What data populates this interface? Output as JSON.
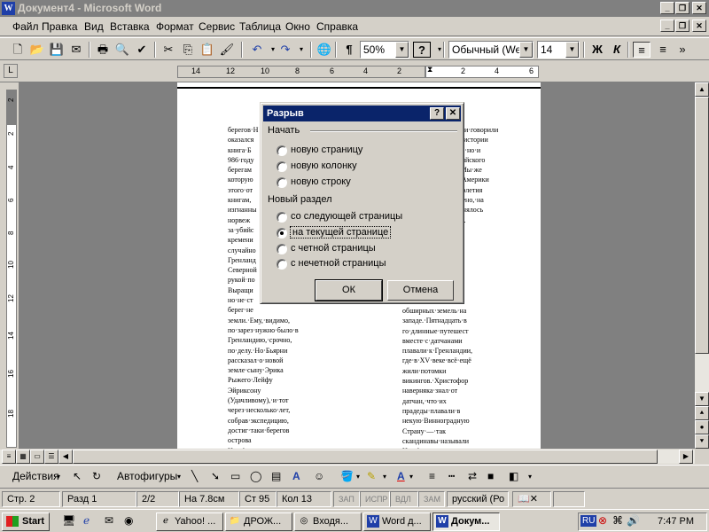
{
  "window": {
    "title": "Документ4 - Microsoft Word",
    "app_icon": "W"
  },
  "menu": [
    "Файл",
    "Правка",
    "Вид",
    "Вставка",
    "Формат",
    "Сервис",
    "Таблица",
    "Окно",
    "Справка"
  ],
  "toolbar": {
    "zoom": "50%",
    "style": "Обычный (Web)",
    "font_size": "14",
    "bold": "Ж",
    "italic": "К",
    "help": "?"
  },
  "ruler": {
    "labels": [
      "14",
      "12",
      "10",
      "8",
      "6",
      "4",
      "2",
      "2",
      "4",
      "6"
    ]
  },
  "vruler": {
    "labels": [
      "2",
      "2",
      "4",
      "6",
      "8",
      "10",
      "12",
      "14",
      "16",
      "18"
    ]
  },
  "document": {
    "col1": "берегов·Н\nоказался\nкнига·Б\n986·году\nберегам\nкоторую\nэтого·от\nкнигам,\nизгнанны\nнорвеж\nза·убийс\nкремени\nслучайно\nГренланд\nСеверной\nрукой·по\nВыращи\nно·не·ст\nберег·не\nземли.·Ему,·видимо,\nпо·зарез·нужно·было·в\nГренландию,·срочно,\nпо·делу.·Но·Бьярни\nрассказал·о·новой\nземле·сыну·Эрика\nРыжего·Лейфу\nЭйриксону\n(Удачливому),·и·тот\nчерез·несколько·лет,\nсобрав·экспедицию,\nдостиг·таки·берегов\nострова\nНьюфаундленд,·что\nнаходится",
    "col2": "обширных·земель·на\nзападе.·Пятнадцать·в\nго·длинные·путешест\nвместе·с·датчанами\nплавали·к·Гренландии,\nгде·в·XV·веке·всё·ещё\nжили·потомки\nвикингов.·Христофор\nнаверняка·знал·от\nдатчан,·что·их\nпрадеды·плавали·в\nнекую·Винноградную\nСтрану·—·так\nскандинавы·называли\nНьюфаундленд.",
    "col3": "ого·ни·говорили\nне·в·истории\nРуси,·но·и\nанглийского\nже.·Мы·же\nния·Америки\nХ·столетия\nточнено,·на\nрединялось\nнном.\nнном"
  },
  "dialog": {
    "title": "Разрыв",
    "group1": "Начать",
    "options1": [
      "новую страницу",
      "новую колонку",
      "новую строку"
    ],
    "group2": "Новый раздел",
    "options2": [
      "со следующей страницы",
      "на текущей странице",
      "с четной страницы",
      "с нечетной страницы"
    ],
    "selected": "на текущей странице",
    "ok": "ОК",
    "cancel": "Отмена",
    "help_btn": "?",
    "close_btn": "✕"
  },
  "drawing": {
    "actions": "Действия",
    "autoshapes": "Автофигуры"
  },
  "status": {
    "page": "Стр. 2",
    "section": "Разд 1",
    "pages": "2/2",
    "at": "На 7.8см",
    "line": "Ст 95",
    "col": "Кол 13",
    "rec": "ЗАП",
    "trk": "ИСПР",
    "ext": "ВДЛ",
    "ovr": "ЗАМ",
    "lang": "русский (Ро"
  },
  "taskbar": {
    "start": "Start",
    "tasks": [
      "Yahoo! ...",
      "ДРОЖ...",
      "Входя...",
      "Word д...",
      "Докум..."
    ],
    "lang": "RU",
    "clock": "7:47 PM"
  },
  "colors": {
    "title_active": "#0a246a",
    "title_inactive": "#808080",
    "face": "#d4d0c8"
  }
}
